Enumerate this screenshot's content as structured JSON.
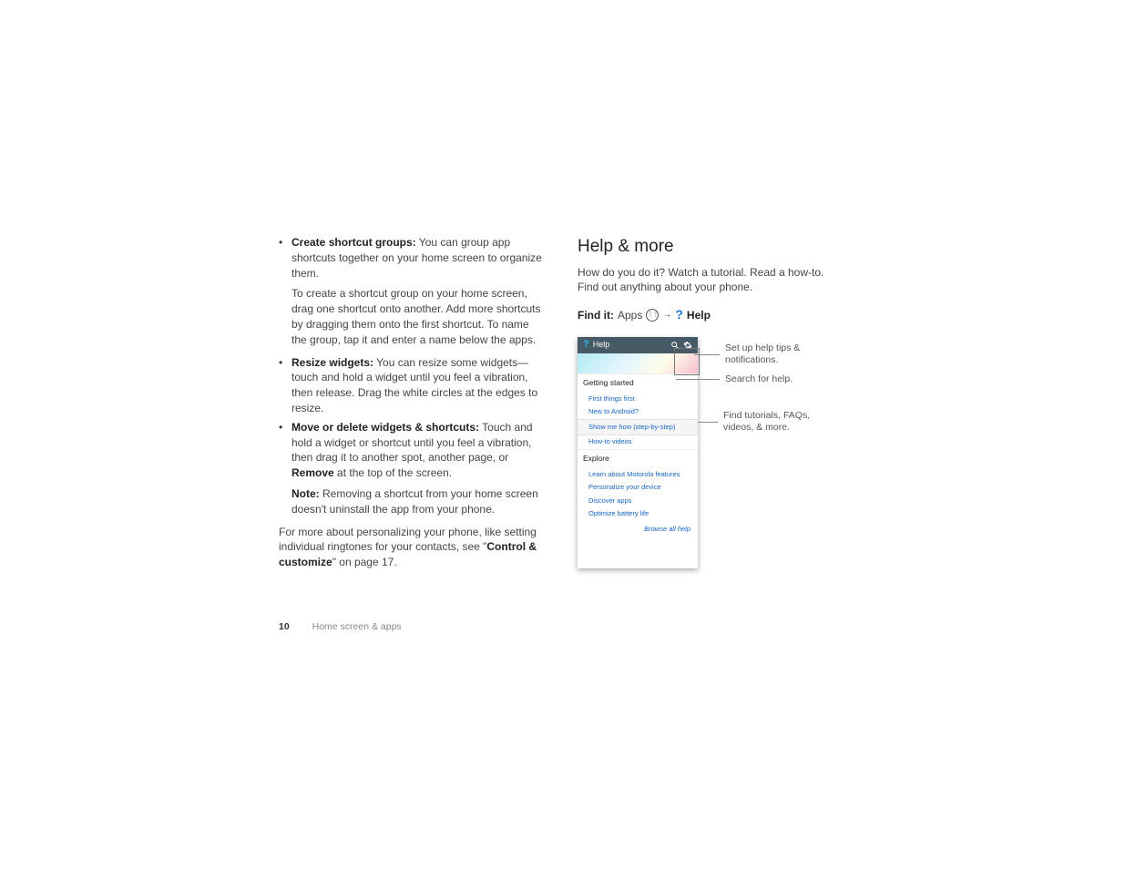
{
  "left": {
    "b1_label": "Create shortcut groups:",
    "b1_text": " You can group app shortcuts together on your home screen to organize them.",
    "b1_para2": "To create a shortcut group on your home screen, drag one shortcut onto another. Add more shortcuts by dragging them onto the first shortcut. To name the group, tap it and enter a name below the apps.",
    "b2_label": "Resize widgets:",
    "b2_text": " You can resize some widgets—touch and hold a widget until you feel a vibration, then release. Drag the white circles at the edges to resize.",
    "b3_label": "Move or delete widgets & shortcuts:",
    "b3_text_a": " Touch and hold a widget or shortcut until you feel a vibration, then drag it to another spot, another page, or ",
    "b3_remove": "Remove",
    "b3_text_b": " at the top of the screen.",
    "b3_note_label": "Note:",
    "b3_note_text": " Removing a shortcut from your home screen doesn't uninstall the app from your phone.",
    "more_a": "For more about personalizing your phone, like setting individual ringtones for your contacts, see \"",
    "more_link": "Control & customize",
    "more_b": "\" on page 17."
  },
  "right": {
    "heading": "Help & more",
    "intro": "How do you do it? Watch a tutorial. Read a how-to. Find out anything about your phone.",
    "find_label": "Find it:",
    "apps_word": "Apps",
    "help_word": "Help"
  },
  "phone": {
    "title": "Help",
    "section1": "Getting started",
    "links1": [
      "First things first",
      "New to Android?",
      "Show me how (step-by-step)",
      "How-to videos"
    ],
    "section2": "Explore",
    "links2": [
      "Learn about Motorola features",
      "Personalize your device",
      "Discover apps",
      "Optimize battery life"
    ],
    "browse": "Browse all help"
  },
  "callouts": {
    "c1": "Set up help tips & notifications.",
    "c2": "Search for help.",
    "c3a": "Find tutorials, FAQs,",
    "c3b": "videos, & more."
  },
  "footer": {
    "page": "10",
    "section": "Home screen & apps"
  }
}
